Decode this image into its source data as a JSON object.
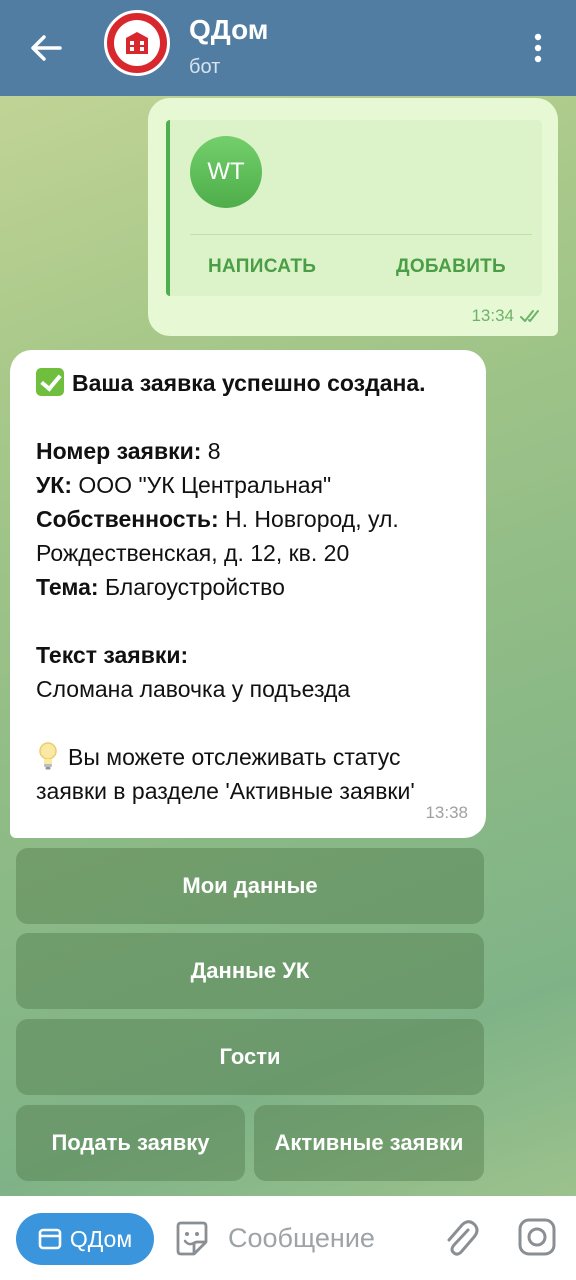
{
  "header": {
    "title": "QДом",
    "subtitle": "бот",
    "back_icon": "arrow-left-icon",
    "more_icon": "more-vertical-icon"
  },
  "contact_message": {
    "initials": "WT",
    "write_label": "НАПИСАТЬ",
    "add_label": "ДОБАВИТЬ",
    "time": "13:34",
    "status_icon": "double-check-icon"
  },
  "bot_message": {
    "title": "Ваша заявка успешно создана.",
    "number_label": "Номер заявки:",
    "number_value": " 8",
    "uk_label": "УК:",
    "uk_value": " ООО \"УК Центральная\"",
    "property_label": "Собственность:",
    "property_value_1": " Н. Новгород, ул.",
    "property_value_2": "Рождественская, д. 12, кв. 20",
    "topic_label": "Тема:",
    "topic_value": " Благоустройство",
    "text_label": "Текст заявки:",
    "text_value": "Сломана лавочка у подъезда",
    "hint_line_1": "Вы можете отслеживать статус",
    "hint_line_2": "заявки в разделе 'Активные заявки'",
    "time": "13:38"
  },
  "keyboard": {
    "my_data": "Мои данные",
    "uk_data": "Данные УК",
    "guests": "Гости",
    "submit_request": "Подать заявку",
    "active_requests": "Активные заявки"
  },
  "input_bar": {
    "menu_label": "QДом",
    "placeholder": "Сообщение"
  },
  "colors": {
    "header": "#517da2",
    "outgoing_bubble": "#e6f9d4",
    "accent_green": "#4a9e45",
    "menu_button": "#3a95dd"
  }
}
